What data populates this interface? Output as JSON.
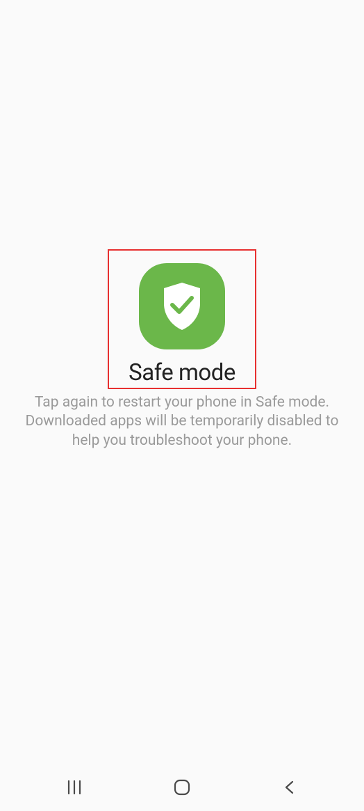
{
  "icon": {
    "name": "shield-check",
    "bg_color": "#6bb74a",
    "fg_color": "#ffffff"
  },
  "title": "Safe mode",
  "description": "Tap again to restart your phone in Safe mode. Downloaded apps will be temporarily disabled to help you troubleshoot your phone.",
  "highlight_border_color": "#e73030",
  "nav": {
    "recent": "recent-apps",
    "home": "home",
    "back": "back"
  }
}
